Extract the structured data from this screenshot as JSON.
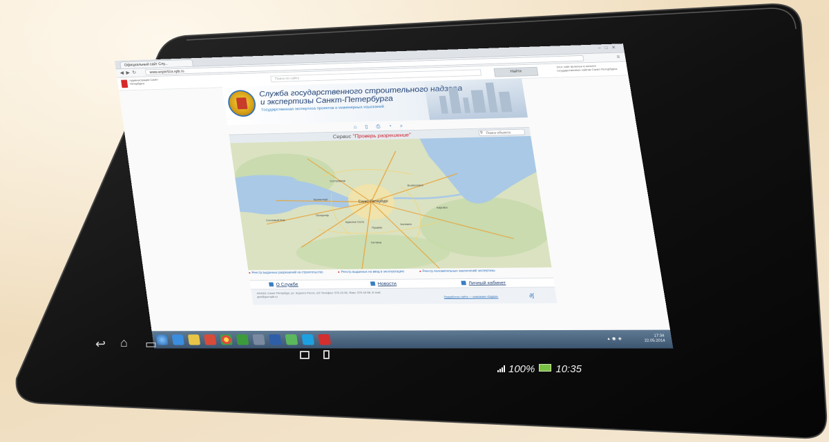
{
  "device": {
    "status_battery": "100%",
    "status_time": "10:35"
  },
  "browser": {
    "tab_title": "Официальный сайт Слу...",
    "url": "www.expertiza.spb.ru"
  },
  "gov_strip": {
    "left_text": "Администрация Санкт-Петербурга",
    "search_placeholder": "Поиск по сайту",
    "find_button": "Найти",
    "right_note": "Этот сайт включен в каталог государственных сайтов Санкт-Петербурга"
  },
  "header": {
    "title_line1": "Служба государственного строительного надзора",
    "title_line2": "и экспертизы Санкт-Петербурга",
    "subtitle": "Государственная экспертиза проектов и инженерных изысканий"
  },
  "map_panel": {
    "service_label": "Сервис",
    "service_name": "\"Проверь разрешение\"",
    "search_placeholder": "Поиск объекта",
    "places": [
      {
        "name": "Санкт-Петербург",
        "kind": "city"
      },
      {
        "name": "Сестрорецк",
        "kind": "town"
      },
      {
        "name": "Кронштадт",
        "kind": "town"
      },
      {
        "name": "Петергоф",
        "kind": "town"
      },
      {
        "name": "Красное Село",
        "kind": "town"
      },
      {
        "name": "Пушкин",
        "kind": "town"
      },
      {
        "name": "Колпино",
        "kind": "town"
      },
      {
        "name": "Кировск",
        "kind": "town"
      },
      {
        "name": "Гатчина",
        "kind": "town"
      },
      {
        "name": "Всеволожск",
        "kind": "town"
      },
      {
        "name": "Сосновый Бор",
        "kind": "town"
      }
    ]
  },
  "legend": [
    "Реестр выданных разрешений на строительство",
    "Реестр выданных на ввод в эксплуатацию",
    "Реестр положительных заключений экспертизы"
  ],
  "nav": {
    "about": "О Службе",
    "news": "Новости",
    "cabinet": "Личный кабинет"
  },
  "footer": {
    "address": "191023, Санкт-Петербург, ул. Зодчего Росси, 1/3 Телефон: 576-15-66, Факс: 576-15-68, E-mail: gne@gov.spb.ru",
    "developer": "Разработка сайта — компания «Digital»"
  },
  "taskbar": {
    "clock_time": "17:34",
    "clock_date": "22.05.2014"
  },
  "colors": {
    "brand_blue": "#1d3f73",
    "accent_red": "#d0202a",
    "link_blue": "#2e6fb8"
  }
}
